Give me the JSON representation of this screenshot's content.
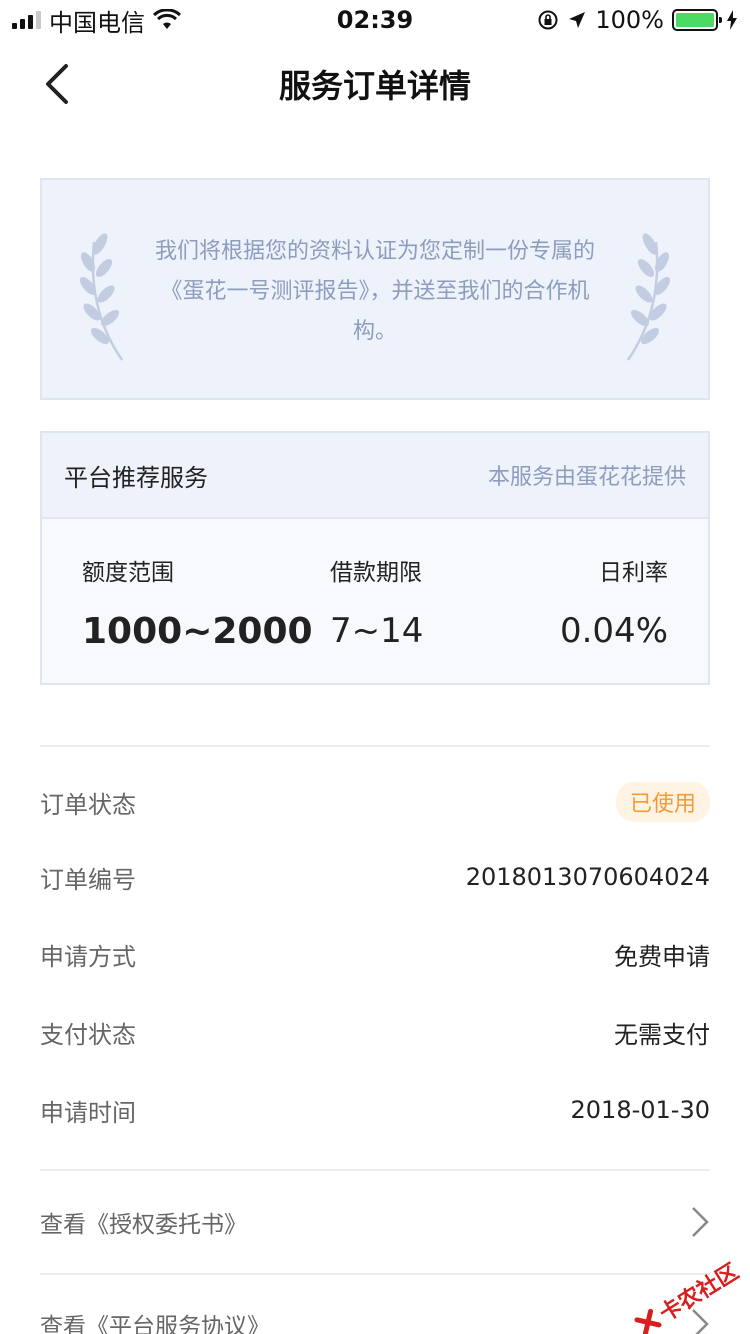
{
  "status_bar": {
    "carrier": "中国电信",
    "time": "02:39",
    "battery": "100%"
  },
  "nav": {
    "title": "服务订单详情"
  },
  "intro": {
    "text": "我们将根据您的资料认证为您定制一份专属的《蛋花一号测评报告》，并送至我们的合作机构。"
  },
  "service": {
    "title": "平台推荐服务",
    "provider": "本服务由蛋花花提供",
    "metrics": [
      {
        "label": "额度范围",
        "value": "1000~2000"
      },
      {
        "label": "借款期限",
        "value": "7~14"
      },
      {
        "label": "日利率",
        "value": "0.04%"
      }
    ]
  },
  "order": {
    "rows": [
      {
        "label": "订单状态",
        "value": "已使用"
      },
      {
        "label": "订单编号",
        "value": "2018013070604024"
      },
      {
        "label": "申请方式",
        "value": "免费申请"
      },
      {
        "label": "支付状态",
        "value": "无需支付"
      },
      {
        "label": "申请时间",
        "value": "2018-01-30"
      }
    ]
  },
  "documents": [
    {
      "label": "查看《授权委托书》"
    },
    {
      "label": "查看《平台服务协议》"
    }
  ],
  "watermark": {
    "text": "卡农社区"
  },
  "colors": {
    "accent_text": "#8d9dbd",
    "status_badge_bg": "#fff4e3",
    "status_badge_text": "#f29b38",
    "battery_green": "#4cd964"
  }
}
